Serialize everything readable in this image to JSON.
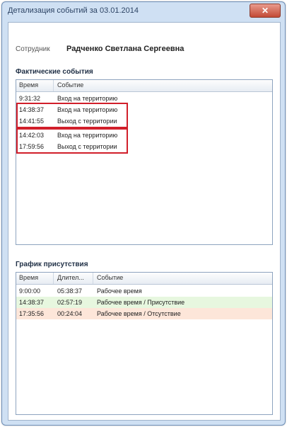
{
  "window": {
    "title": "Детализация событий за 03.01.2014",
    "close_glyph": "✕"
  },
  "employee": {
    "label": "Сотрудник",
    "name": "Радченко Светлана Сергеевна"
  },
  "events": {
    "section_title": "Фактические события",
    "columns": [
      "Время",
      "Событие"
    ],
    "rows": [
      {
        "time": "9:31:32",
        "event": "Вход на территорию"
      },
      {
        "time": "14:38:37",
        "event": "Вход на территорию"
      },
      {
        "time": "14:41:55",
        "event": "Выход с территории"
      },
      {
        "time": "14:42:03",
        "event": "Вход на территорию"
      },
      {
        "time": "17:59:56",
        "event": "Выход с территории"
      }
    ]
  },
  "presence": {
    "section_title": "График присутствия",
    "columns": [
      "Время",
      "Длител...",
      "Событие"
    ],
    "rows": [
      {
        "time": "9:00:00",
        "duration": "05:38:37",
        "event": "Рабочее время",
        "bg": "#ffffff"
      },
      {
        "time": "14:38:37",
        "duration": "02:57:19",
        "event": "Рабочее время / Присутствие",
        "bg": "#e7f7df"
      },
      {
        "time": "17:35:56",
        "duration": "00:24:04",
        "event": "Рабочее время / Отсутствие",
        "bg": "#fde6d9"
      }
    ]
  },
  "colors": {
    "highlight_border": "#d11f2a",
    "accent_title": "#2c4364"
  }
}
